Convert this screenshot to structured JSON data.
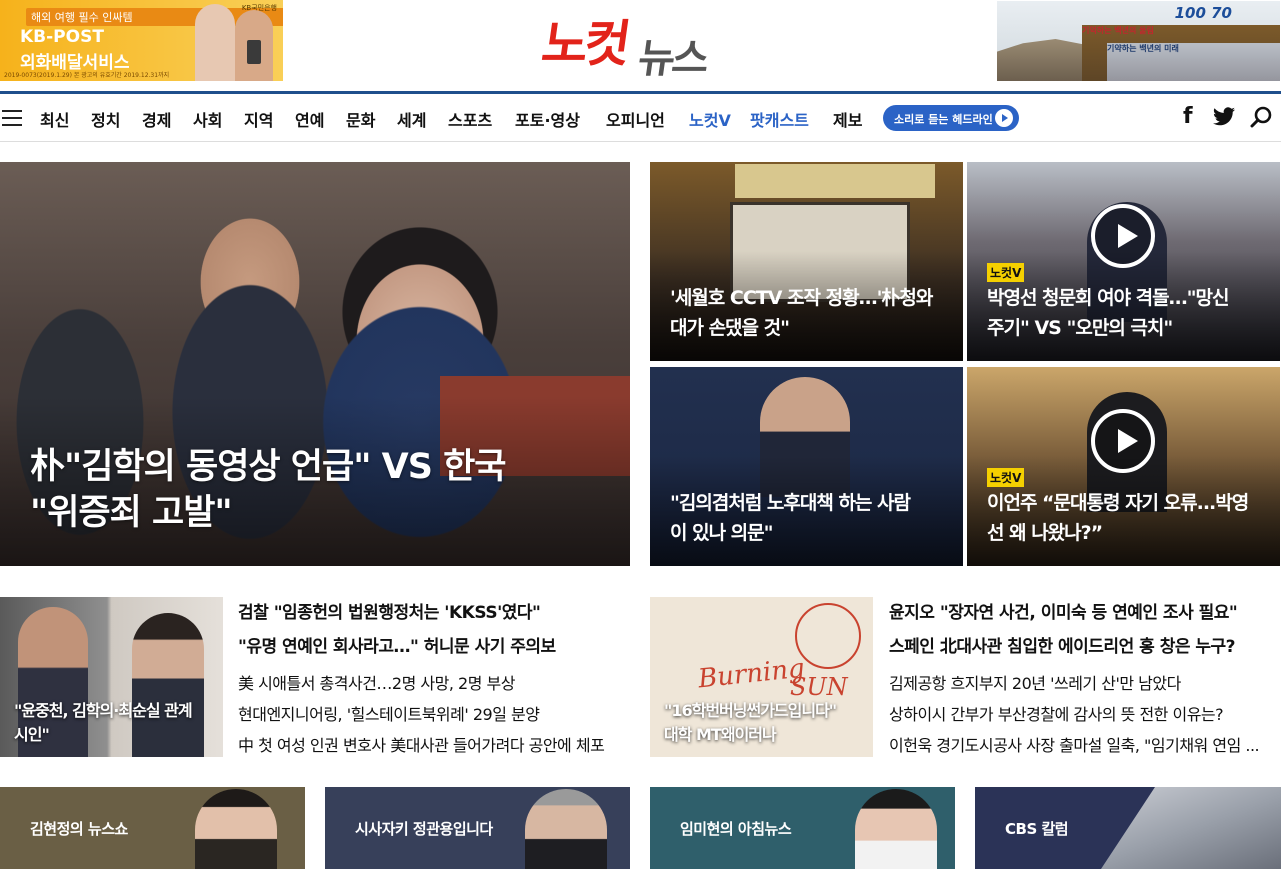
{
  "header": {
    "ad_left": {
      "line1": "해외 여행 필수 인싸템",
      "line2": "KB-POST",
      "line3": "외화배달서비스",
      "brand": "KB국민은행",
      "fineprint": "2019-0073(2019.1.29) 본 광고의 유효기간 2019.12.31까지"
    },
    "logo": {
      "part1": "노컷",
      "part2": "뉴스"
    },
    "ad_right": {
      "badge": "100 70",
      "line1": "기억하는 백년의 울림",
      "line2": "기약하는 백년의 미래"
    }
  },
  "nav": {
    "items": [
      {
        "label": "최신"
      },
      {
        "label": "정치"
      },
      {
        "label": "경제"
      },
      {
        "label": "사회"
      },
      {
        "label": "지역"
      },
      {
        "label": "연예"
      },
      {
        "label": "문화"
      },
      {
        "label": "세계"
      },
      {
        "label": "스포츠"
      },
      {
        "label": "포토·영상"
      },
      {
        "label": "오피니언"
      },
      {
        "label": "노컷V"
      },
      {
        "label": "팟캐스트"
      },
      {
        "label": "제보"
      }
    ],
    "headline_button": "소리로 듣는 헤드라인",
    "social": {
      "facebook": "f",
      "twitter": "🐦",
      "search": "⌕"
    },
    "accent_color": "#2b63c6"
  },
  "hero": {
    "title_line1": "朴\"김학의 동영상 언급\" VS 한국",
    "title_line2": "\"위증죄 고발\""
  },
  "tiles": [
    {
      "title_line1": "'세월호 CCTV 조작 정황…'朴청와",
      "title_line2": "대가 손댔을 것\"",
      "badge": ""
    },
    {
      "title_line1": "박영선 청문회 여야 격돌…\"망신",
      "title_line2": "주기\" VS \"오만의 극치\"",
      "badge": "노컷V"
    },
    {
      "title_line1": "\"김의겸처럼 노후대책 하는 사람",
      "title_line2": "이 있나 의문\"",
      "badge": ""
    },
    {
      "title_line1": "이언주 “문대통령 자기 오류...박영",
      "title_line2": "선 왜 나왔나?”",
      "badge": "노컷V"
    }
  ],
  "row2": {
    "left_thumb": {
      "caption_line1": "\"윤중천, 김학의·최순실 관계",
      "caption_line2": "시인\""
    },
    "left_list": [
      "검찰 \"임종헌의 법원행정처는 'KKSS'였다\"",
      "\"유명 연예인 회사라고…\" 허니문 사기 주의보",
      "美 시애틀서 총격사건…2명 사망, 2명 부상",
      "현대엔지니어링, '힐스테이트북위례' 29일 분양",
      "中 첫 여성 인권 변호사 美대사관 들어가려다 공안에 체포"
    ],
    "right_thumb": {
      "caption_line1": "\"16학번버닝썬가드입니다\"",
      "caption_line2": "대학 MT왜이러나",
      "image_text1": "Burning",
      "image_text2": "SUN"
    },
    "right_list": [
      "윤지오 \"장자연 사건, 이미숙 등 연예인 조사 필요\"",
      "스페인 北대사관 침입한 에이드리언 홍 창은 누구?",
      "김제공항 흐지부지 20년 '쓰레기 산'만 남았다",
      "상하이시 간부가 부산경찰에 감사의 뜻 전한 이유는?",
      "이헌욱 경기도시공사 사장 출마설 일축, \"임기채워 연임 ..."
    ]
  },
  "banners": [
    {
      "label": "김현정의 뉴스쇼",
      "color": "#6a5f45"
    },
    {
      "label": "시사자키 정관용입니다",
      "color": "#37405a"
    },
    {
      "label": "임미현의 아침뉴스",
      "color": "#2f5f6b"
    },
    {
      "label": "CBS 칼럼",
      "color": "#2b3357"
    }
  ]
}
